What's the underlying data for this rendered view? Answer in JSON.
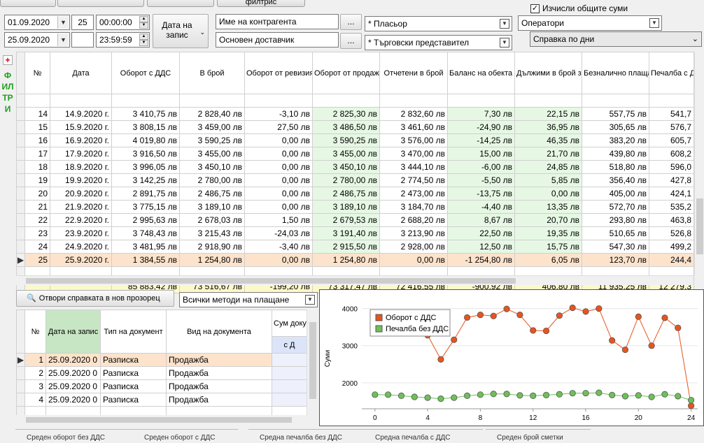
{
  "toolbar": {
    "top_button_label": "филтрис"
  },
  "filters": {
    "date_from": "01.09.2020",
    "date_to": "25.09.2020",
    "time_from": "00:00:00",
    "time_to": "23:59:59",
    "number_field": "25",
    "date_record_btn": "Дата на запис",
    "counterparty_name": "Име на контрагента",
    "main_supplier": "Основен доставчик",
    "ellipsis": "...",
    "placement": "* Пласьор",
    "sales_rep": "* Търговски представител",
    "calc_totals": "Изчисли общите суми",
    "operators": "Оператори",
    "report_type": "Справка по дни",
    "side_label": "ФИЛТРИ",
    "plus": "+"
  },
  "main_table": {
    "headers": [
      "№",
      "Дата",
      "Оборот с ДДС",
      "В брой",
      "Оборот от ревизия",
      "Оборот от продажби в брой + ревизия",
      "Отчетени в брой",
      "Баланс на обекта оборот в брой + ревизия - отчетени",
      "Дължими в брой за деня",
      "Безналично плащане",
      "Печалба с ДДС"
    ],
    "rows": [
      [
        "14",
        "14.9.2020 г.",
        "3 410,75 лв",
        "2 828,40 лв",
        "-3,10 лв",
        "2 825,30 лв",
        "2 832,60 лв",
        "7,30 лв",
        "22,15 лв",
        "557,75 лв",
        "541,7"
      ],
      [
        "15",
        "15.9.2020 г.",
        "3 808,15 лв",
        "3 459,00 лв",
        "27,50 лв",
        "3 486,50 лв",
        "3 461,60 лв",
        "-24,90 лв",
        "36,95 лв",
        "305,65 лв",
        "576,7"
      ],
      [
        "16",
        "16.9.2020 г.",
        "4 019,80 лв",
        "3 590,25 лв",
        "0,00 лв",
        "3 590,25 лв",
        "3 576,00 лв",
        "-14,25 лв",
        "46,35 лв",
        "383,20 лв",
        "605,7"
      ],
      [
        "17",
        "17.9.2020 г.",
        "3 916,50 лв",
        "3 455,00 лв",
        "0,00 лв",
        "3 455,00 лв",
        "3 470,00 лв",
        "15,00 лв",
        "21,70 лв",
        "439,80 лв",
        "608,2"
      ],
      [
        "18",
        "18.9.2020 г.",
        "3 996,05 лв",
        "3 450,10 лв",
        "0,00 лв",
        "3 450,10 лв",
        "3 444,10 лв",
        "-6,00 лв",
        "24,85 лв",
        "518,80 лв",
        "596,0"
      ],
      [
        "19",
        "19.9.2020 г.",
        "3 142,25 лв",
        "2 780,00 лв",
        "0,00 лв",
        "2 780,00 лв",
        "2 774,50 лв",
        "-5,50 лв",
        "5,85 лв",
        "356,40 лв",
        "427,8"
      ],
      [
        "20",
        "20.9.2020 г.",
        "2 891,75 лв",
        "2 486,75 лв",
        "0,00 лв",
        "2 486,75 лв",
        "2 473,00 лв",
        "-13,75 лв",
        "0,00 лв",
        "405,00 лв",
        "424,1"
      ],
      [
        "21",
        "21.9.2020 г.",
        "3 775,15 лв",
        "3 189,10 лв",
        "0,00 лв",
        "3 189,10 лв",
        "3 184,70 лв",
        "-4,40 лв",
        "13,35 лв",
        "572,70 лв",
        "535,2"
      ],
      [
        "22",
        "22.9.2020 г.",
        "2 995,63 лв",
        "2 678,03 лв",
        "1,50 лв",
        "2 679,53 лв",
        "2 688,20 лв",
        "8,67 лв",
        "20,70 лв",
        "293,80 лв",
        "463,8"
      ],
      [
        "23",
        "23.9.2020 г.",
        "3 748,43 лв",
        "3 215,43 лв",
        "-24,03 лв",
        "3 191,40 лв",
        "3 213,90 лв",
        "22,50 лв",
        "19,35 лв",
        "510,65 лв",
        "526,8"
      ],
      [
        "24",
        "24.9.2020 г.",
        "3 481,95 лв",
        "2 918,90 лв",
        "-3,40 лв",
        "2 915,50 лв",
        "2 928,00 лв",
        "12,50 лв",
        "15,75 лв",
        "547,30 лв",
        "499,2"
      ],
      [
        "25",
        "25.9.2020 г.",
        "1 384,55 лв",
        "1 254,80 лв",
        "0,00 лв",
        "1 254,80 лв",
        "0,00 лв",
        "-1 254,80 лв",
        "6,05 лв",
        "123,70 лв",
        "244,4"
      ]
    ],
    "totals": [
      "",
      "",
      "85 883,42 лв",
      "73 516,67 лв",
      "-199,20 лв",
      "73 317,47 лв",
      "72 416,55 лв",
      "-900,92 лв",
      "406,80 лв",
      "11 935,25 лв",
      "12 279,3"
    ]
  },
  "lower": {
    "open_report_btn": "Отвори справката в нов прозорец",
    "payment_methods": "Всички методи на плащане",
    "headers": [
      "№",
      "Дата на запис",
      "Тип на документ",
      "Вид на документа",
      "Сум доку"
    ],
    "subheader": "с Д",
    "rows": [
      [
        "1",
        "25.09.2020 0",
        "Разписка",
        "Продажба"
      ],
      [
        "2",
        "25.09.2020 0",
        "Разписка",
        "Продажба"
      ],
      [
        "3",
        "25.09.2020 0",
        "Разписка",
        "Продажба"
      ],
      [
        "4",
        "25.09.2020 0",
        "Разписка",
        "Продажба"
      ]
    ]
  },
  "chart_data": {
    "type": "line",
    "ylabel": "Суми",
    "x": [
      0,
      1,
      2,
      3,
      4,
      5,
      6,
      7,
      8,
      9,
      10,
      11,
      12,
      13,
      14,
      15,
      16,
      17,
      18,
      19,
      20,
      21,
      22,
      23,
      24
    ],
    "x_ticks": [
      "0",
      "4",
      "8",
      "12",
      "16",
      "20",
      "24"
    ],
    "y_ticks": [
      "2000",
      "3000",
      "4000"
    ],
    "ylim": [
      1300,
      4350
    ],
    "xlim": [
      -1,
      24.5
    ],
    "series": [
      {
        "name": "Оборот с ДДС",
        "color": "#e8541e",
        "values": [
          3700,
          3420,
          3360,
          3350,
          3280,
          2630,
          3160,
          3760,
          3830,
          3800,
          3990,
          3830,
          3410,
          3400,
          3810,
          4020,
          3920,
          4000,
          3140,
          2890,
          3780,
          3000,
          3750,
          3480,
          1380
        ]
      },
      {
        "name": "Печалба без ДДС",
        "color": "#6fbf5a",
        "values": [
          1680,
          1680,
          1650,
          1620,
          1600,
          1570,
          1600,
          1650,
          1680,
          1700,
          1700,
          1660,
          1650,
          1670,
          1690,
          1720,
          1720,
          1730,
          1670,
          1640,
          1660,
          1620,
          1690,
          1640,
          1530
        ]
      }
    ],
    "legend": "top-left"
  },
  "bottombar": {
    "items": [
      "Среден оборот без ДДС",
      "Среден оборот с ДДС",
      "Средна печалба без ДДС",
      "Средна печалба с ДДС",
      "Среден брой сметки"
    ]
  }
}
